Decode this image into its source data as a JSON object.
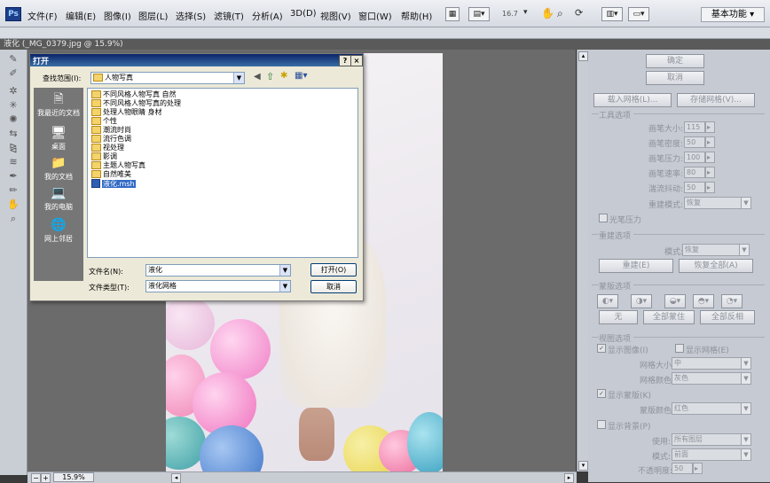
{
  "app": {
    "logo": "Ps"
  },
  "menu": [
    "文件(F)",
    "编辑(E)",
    "图像(I)",
    "图层(L)",
    "选择(S)",
    "滤镜(T)",
    "分析(A)",
    "3D(D)",
    "视图(V)",
    "窗口(W)",
    "帮助(H)"
  ],
  "toolbar": {
    "zoom": "16.7",
    "workspace": "基本功能"
  },
  "document": {
    "tab_title": "液化 (_MG_0379.jpg @ 15.9%)",
    "zoom_field": "15.9%"
  },
  "dialog": {
    "title": "打开",
    "lookin_label": "查找范围(I):",
    "lookin_value": "人物写真",
    "places": [
      {
        "label": "我最近的文档",
        "icon": "recent-docs-icon"
      },
      {
        "label": "桌面",
        "icon": "desktop-icon"
      },
      {
        "label": "我的文档",
        "icon": "my-documents-icon"
      },
      {
        "label": "我的电脑",
        "icon": "my-computer-icon"
      },
      {
        "label": "网上邻居",
        "icon": "network-icon"
      }
    ],
    "files": [
      "不同风格人物写真 自然",
      "不同风格人物写真的处理",
      "处理人物眼睛 身材",
      "个性",
      "潮流时尚",
      "流行色调",
      "视处理",
      "影调",
      "主题人物写真",
      "自然唯美",
      "液化.msh"
    ],
    "filename_label": "文件名(N):",
    "filename_value": "液化",
    "filetype_label": "文件类型(T):",
    "filetype_value": "液化网格",
    "open_button": "打开(O)",
    "cancel_button": "取消",
    "help_button": "?",
    "close_button": "×"
  },
  "panel": {
    "ok": "确定",
    "cancel": "取消",
    "load_mesh": "载入网格(L)...",
    "save_mesh": "存储网格(V)...",
    "tool_options": {
      "title": "工具选项",
      "fields": [
        {
          "label": "画笔大小:",
          "value": "115"
        },
        {
          "label": "画笔密度:",
          "value": "50"
        },
        {
          "label": "画笔压力:",
          "value": "100"
        },
        {
          "label": "画笔速率:",
          "value": "80"
        },
        {
          "label": "湍流抖动:",
          "value": "50"
        }
      ],
      "rebuild_mode_label": "重建模式:",
      "rebuild_mode_value": "恢复",
      "stylus_label": "光笔压力"
    },
    "rebuild": {
      "title": "重建选项",
      "mode_label": "模式:",
      "mode_value": "恢复",
      "rebuild_button": "重建(E)",
      "restore_all_button": "恢复全部(A)"
    },
    "mask": {
      "title": "蒙版选项",
      "none": "无",
      "mask_all": "全部蒙住",
      "invert_all": "全部反相"
    },
    "view": {
      "title": "视图选项",
      "show_image": "显示图像(I)",
      "show_mesh": "显示网格(E)",
      "mesh_size_label": "网格大小:",
      "mesh_size_value": "中",
      "mesh_color_label": "网格颜色:",
      "mesh_color_value": "灰色",
      "show_mask": "显示蒙版(K)",
      "mask_color_label": "蒙版颜色:",
      "mask_color_value": "红色",
      "show_backdrop": "显示背景(P)",
      "use_label": "使用:",
      "use_value": "所有图层",
      "mode_label": "模式:",
      "mode_value": "前面",
      "opacity_label": "不透明度:",
      "opacity_value": "50"
    }
  }
}
